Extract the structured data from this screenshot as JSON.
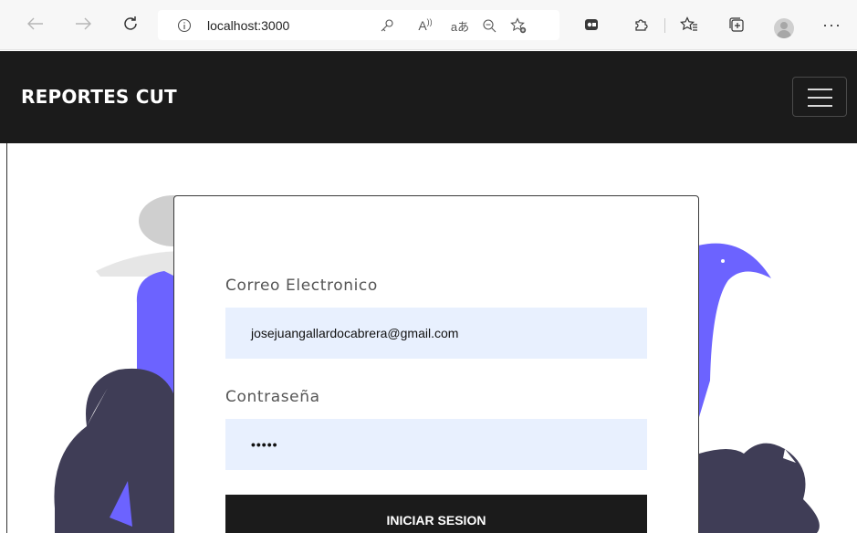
{
  "browser": {
    "url": "localhost:3000",
    "reader_label": "A",
    "translate_label": "aあ"
  },
  "navbar": {
    "brand": "REPORTES CUT"
  },
  "login": {
    "email_label": "Correo Electronico",
    "email_value": "josejuangallardocabrera@gmail.com",
    "password_label": "Contraseña",
    "password_value": "•••••",
    "submit_label": "INICIAR SESION"
  },
  "colors": {
    "navbar_bg": "#1b1b1b",
    "input_bg": "#e8f0fe",
    "accent_purple": "#6c63ff",
    "dark_bush": "#3f3d56"
  }
}
